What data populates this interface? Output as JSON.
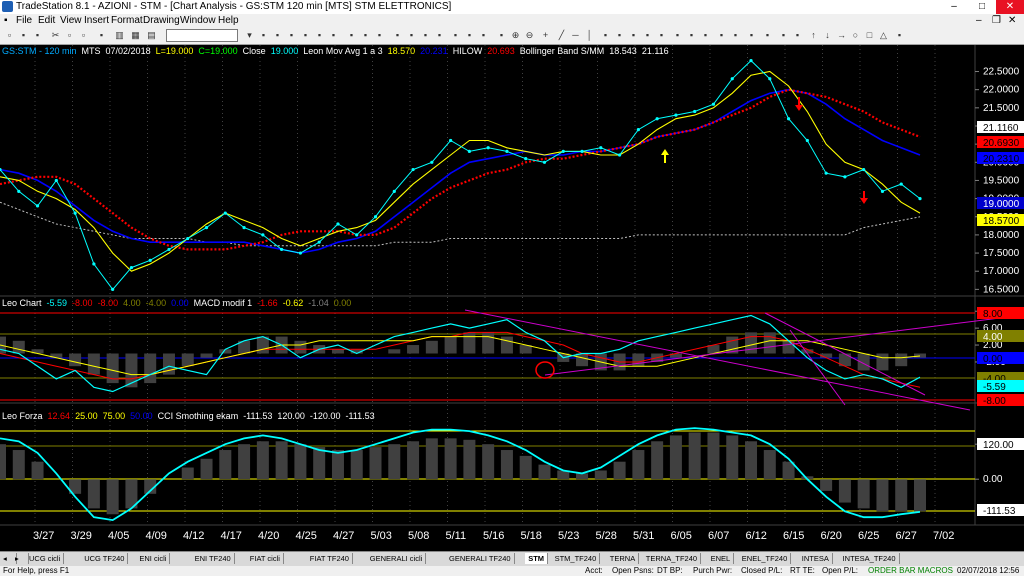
{
  "window": {
    "title": "TradeStation 8.1 - AZIONI - STM - [Chart Analysis - GS:STM  120 min  [MTS] STM ELETTRONICS]",
    "minimize": "–",
    "maximize": "□",
    "close": "✕"
  },
  "menu": [
    "File",
    "Edit",
    "View",
    "Insert",
    "Format",
    "Drawing",
    "Window",
    "Help"
  ],
  "chart_data": [
    {
      "type": "line",
      "pane": "price",
      "title": "GS:STM - 120 min",
      "legend": [
        {
          "text": "GS:STM - 120 min",
          "color": "#00aaff"
        },
        {
          "text": "MTS",
          "color": "#ffffff"
        },
        {
          "text": "07/02/2018",
          "color": "#ffffff"
        },
        {
          "text": "L=19.000",
          "color": "#ffff00"
        },
        {
          "text": "C=19.000",
          "color": "#00ff00"
        },
        {
          "text": "Close",
          "color": "#ffffff"
        },
        {
          "text": "19.000",
          "color": "#00ffff"
        },
        {
          "text": "Leon Mov Avg 1 a 3",
          "color": "#ffffff"
        },
        {
          "text": "18.570",
          "color": "#ffff00"
        },
        {
          "text": "20.231",
          "color": "#0000ff"
        },
        {
          "text": "HILOW",
          "color": "#ffffff"
        },
        {
          "text": "20.693",
          "color": "#ff0000"
        },
        {
          "text": "Bollinger Band S/MM",
          "color": "#ffffff"
        },
        {
          "text": "18.543",
          "color": "#ffffff"
        },
        {
          "text": "21.116",
          "color": "#ffffff"
        }
      ],
      "yticks": [
        "22.5000",
        "22.0000",
        "21.5000",
        "21.0000",
        "20.5000",
        "20.0000",
        "19.5000",
        "19.0000",
        "18.5000",
        "18.0000",
        "17.5000",
        "17.0000",
        "16.5000"
      ],
      "value_tags": [
        {
          "text": "21.1160",
          "bg": "#ffffff",
          "fg": "#000000"
        },
        {
          "text": "20.6930",
          "bg": "#ff0000",
          "fg": "#000000"
        },
        {
          "text": "20.2310",
          "bg": "#0000ff",
          "fg": "#000000"
        },
        {
          "text": "19.0000",
          "bg": "#0000cc",
          "fg": "#ffffff"
        },
        {
          "text": "18.5700",
          "bg": "#ffff00",
          "fg": "#000000"
        }
      ],
      "ylim": [
        16.4,
        22.9
      ],
      "series": [
        {
          "name": "Close",
          "color": "#00ffff",
          "values": [
            19.8,
            19.2,
            18.8,
            19.5,
            18.6,
            17.2,
            16.5,
            17.1,
            17.3,
            17.6,
            17.9,
            18.2,
            18.6,
            18.2,
            18.0,
            17.6,
            17.5,
            17.8,
            18.3,
            18.0,
            18.5,
            19.2,
            19.8,
            20.0,
            20.6,
            20.3,
            20.4,
            20.3,
            20.1,
            20.0,
            20.3,
            20.3,
            20.4,
            20.2,
            20.9,
            21.2,
            21.3,
            21.4,
            21.6,
            22.3,
            22.8,
            22.3,
            21.2,
            20.6,
            19.7,
            19.6,
            19.8,
            19.2,
            19.4,
            19.0
          ]
        },
        {
          "name": "Leon Mov Avg 1 a 3",
          "color": "#ffff00",
          "values": [
            19.6,
            19.5,
            19.2,
            19.0,
            18.7,
            18.2,
            17.5,
            17.0,
            17.2,
            17.5,
            17.9,
            18.3,
            18.6,
            18.4,
            18.2,
            17.9,
            17.7,
            17.9,
            18.1,
            18.2,
            18.4,
            18.9,
            19.4,
            19.8,
            20.2,
            20.6,
            20.6,
            20.4,
            20.3,
            20.2,
            20.3,
            20.3,
            20.2,
            20.2,
            20.5,
            20.9,
            21.2,
            21.3,
            21.5,
            21.9,
            22.4,
            22.5,
            22.1,
            21.4,
            20.5,
            20.0,
            19.8,
            19.4,
            18.9,
            18.6
          ]
        },
        {
          "name": "Leon Mov Avg (blue)",
          "color": "#0000ff",
          "values": [
            19.8,
            19.7,
            19.5,
            19.2,
            18.8,
            18.4,
            18.1,
            17.9,
            17.8,
            17.8,
            17.8,
            17.8,
            17.8,
            17.8,
            17.7,
            17.6,
            17.5,
            17.6,
            17.8,
            17.9,
            18.1,
            18.5,
            18.9,
            19.3,
            19.7,
            20.0,
            20.1,
            20.2,
            20.3,
            20.2,
            20.2,
            20.3,
            20.3,
            20.4,
            20.5,
            20.7,
            20.8,
            20.9,
            21.1,
            21.4,
            21.7,
            21.9,
            22.0,
            21.9,
            21.6,
            21.2,
            20.9,
            20.6,
            20.4,
            20.2
          ]
        },
        {
          "name": "HILOW",
          "color": "#ff0000",
          "values": [
            19.4,
            19.5,
            19.6,
            19.6,
            19.4,
            19.0,
            18.6,
            18.2,
            17.9,
            17.7,
            17.6,
            17.6,
            17.6,
            17.7,
            17.8,
            18.0,
            18.1,
            18.1,
            18.1,
            18.0,
            18.0,
            18.2,
            18.6,
            19.0,
            19.3,
            19.5,
            19.7,
            19.8,
            20.0,
            20.1,
            20.1,
            20.2,
            20.3,
            20.4,
            20.5,
            20.7,
            20.8,
            20.9,
            21.1,
            21.3,
            21.5,
            21.8,
            22.0,
            21.9,
            21.8,
            21.6,
            21.4,
            21.1,
            20.9,
            20.7
          ]
        },
        {
          "name": "Bollinger Band S/MM",
          "color": "#c0c0c0",
          "values": [
            18.9,
            18.7,
            18.5,
            18.3,
            18.2,
            18.1,
            18.0,
            17.9,
            17.9,
            17.9,
            17.9,
            17.8,
            17.8,
            17.7,
            17.7,
            17.7,
            17.7,
            17.7,
            17.7,
            17.7,
            17.7,
            17.8,
            17.8,
            17.8,
            17.9,
            17.9,
            17.9,
            17.9,
            17.9,
            17.9,
            17.9,
            17.9,
            17.9,
            17.9,
            18.0,
            18.0,
            18.0,
            18.0,
            18.0,
            18.0,
            18.0,
            18.0,
            18.0,
            18.0,
            18.0,
            18.0,
            18.2,
            18.3,
            18.4,
            18.5
          ]
        }
      ]
    },
    {
      "type": "line",
      "pane": "macd",
      "legend": [
        {
          "text": "Leo Chart",
          "color": "#ffffff"
        },
        {
          "text": "-5.59",
          "color": "#00ffff"
        },
        {
          "text": "-8.00",
          "color": "#ff0000"
        },
        {
          "text": "-8.00",
          "color": "#ff0000"
        },
        {
          "text": "4.00",
          "color": "#808000"
        },
        {
          "text": "-4.00",
          "color": "#808000"
        },
        {
          "text": "0.00",
          "color": "#0000ff"
        },
        {
          "text": "MACD modif 1",
          "color": "#ffffff"
        },
        {
          "text": "-1.66",
          "color": "#ff0000"
        },
        {
          "text": "-0.62",
          "color": "#ffff00"
        },
        {
          "text": "-1.04",
          "color": "#808080"
        },
        {
          "text": "0.00",
          "color": "#808000"
        }
      ],
      "yticks": [
        "10.00",
        "6.00",
        "2.00",
        "-2.00"
      ],
      "value_tags": [
        {
          "text": "8.00",
          "bg": "#ff0000",
          "fg": "#000000"
        },
        {
          "text": "4.00",
          "bg": "#808000",
          "fg": "#ffffff"
        },
        {
          "text": "0.00",
          "bg": "#0000ff",
          "fg": "#000000"
        },
        {
          "text": "-4.00",
          "bg": "#808000",
          "fg": "#000000"
        },
        {
          "text": "-5.59",
          "bg": "#00ffff",
          "fg": "#000000"
        },
        {
          "text": "-8.00",
          "bg": "#ff0000",
          "fg": "#000000"
        }
      ],
      "ylim": [
        -11,
        11
      ],
      "series": [
        {
          "name": "Leo Chart",
          "color": "#00ffff",
          "values": [
            1,
            0,
            -3,
            -6,
            -4,
            -8,
            -9,
            -7,
            -5,
            -3,
            -4,
            -5,
            1,
            3,
            4,
            2,
            -1,
            1,
            2,
            0,
            2,
            4,
            5,
            6,
            7,
            6,
            7,
            8,
            5,
            3,
            -1,
            0,
            0,
            1,
            3,
            4,
            5,
            6,
            7,
            8,
            9,
            7,
            3,
            -1,
            -4,
            -6,
            -5,
            -6,
            -8,
            -5.6
          ]
        },
        {
          "name": "MACD modif 1",
          "color": "#ff0000",
          "values": [
            0,
            -1,
            -2,
            -3,
            -4,
            -5,
            -6,
            -6,
            -5,
            -4,
            -3,
            -2,
            -1,
            0,
            1,
            1,
            1,
            1,
            1,
            1,
            1,
            2,
            3,
            4,
            4,
            5,
            5,
            5,
            4,
            3,
            2,
            0,
            -1,
            -2,
            -2,
            -1,
            0,
            1,
            2,
            3,
            4,
            4,
            3,
            1,
            -1,
            -3,
            -5,
            -6,
            -7,
            -8
          ]
        },
        {
          "name": "signal",
          "color": "#ffff00",
          "values": [
            2,
            1,
            0,
            -1,
            -2,
            -3,
            -4,
            -5,
            -5,
            -4,
            -3,
            -2,
            -1,
            0,
            1,
            2,
            2,
            3,
            3,
            3,
            3,
            3,
            3,
            4,
            4,
            4,
            4,
            3,
            2,
            1,
            0,
            -1,
            -2,
            -3,
            -3,
            -3,
            -2,
            -1,
            0,
            1,
            2,
            3,
            3,
            3,
            2,
            1,
            0,
            -1,
            -1,
            -0.6
          ]
        },
        {
          "name": "histogram",
          "color": "#808080",
          "values": [
            4,
            3,
            1,
            -1,
            -3,
            -5,
            -7,
            -8,
            -7,
            -5,
            -3,
            -1,
            1,
            3,
            4,
            4,
            3,
            2,
            1,
            1,
            0,
            1,
            2,
            3,
            4,
            5,
            5,
            4,
            2,
            0,
            -2,
            -3,
            -4,
            -4,
            -3,
            -2,
            -1,
            0,
            2,
            4,
            5,
            5,
            3,
            1,
            -1,
            -3,
            -4,
            -4,
            -3,
            -1
          ]
        }
      ]
    },
    {
      "type": "line",
      "pane": "cci",
      "legend": [
        {
          "text": "Leo Forza",
          "color": "#ffffff"
        },
        {
          "text": "12.64",
          "color": "#ff0000"
        },
        {
          "text": "25.00",
          "color": "#ffff00"
        },
        {
          "text": "75.00",
          "color": "#ffff00"
        },
        {
          "text": "50.00",
          "color": "#0000ff"
        },
        {
          "text": "CCI Smothing ekam",
          "color": "#ffffff"
        },
        {
          "text": "-111.53",
          "color": "#ffffff"
        },
        {
          "text": "120.00",
          "color": "#ffffff"
        },
        {
          "text": "-120.00",
          "color": "#ffffff"
        },
        {
          "text": "-111.53",
          "color": "#ffffff"
        }
      ],
      "yticks": [
        "120.00",
        "0.00"
      ],
      "value_tags": [
        {
          "text": "120.00",
          "bg": "#ffffff",
          "fg": "#000000"
        },
        {
          "text": "-111.53",
          "bg": "#ffffff",
          "fg": "#000000"
        }
      ],
      "ylim": [
        -150,
        220
      ],
      "series": [
        {
          "name": "Leo Forza / CCI",
          "color": "#00ffff",
          "values": [
            140,
            130,
            90,
            20,
            -60,
            -130,
            -140,
            -100,
            -40,
            20,
            60,
            90,
            120,
            140,
            150,
            140,
            120,
            100,
            90,
            100,
            120,
            140,
            160,
            170,
            170,
            165,
            150,
            130,
            100,
            60,
            30,
            20,
            40,
            80,
            120,
            150,
            170,
            175,
            170,
            160,
            150,
            120,
            70,
            0,
            -60,
            -110,
            -130,
            -130,
            -120,
            -112
          ]
        },
        {
          "name": "CCI Smothing ekam",
          "color": "#808080",
          "values": [
            120,
            100,
            60,
            0,
            -50,
            -100,
            -120,
            -100,
            -50,
            0,
            40,
            70,
            100,
            120,
            130,
            130,
            120,
            110,
            100,
            100,
            110,
            120,
            130,
            140,
            140,
            135,
            120,
            100,
            80,
            50,
            30,
            20,
            30,
            60,
            100,
            130,
            150,
            160,
            160,
            150,
            130,
            100,
            60,
            10,
            -40,
            -80,
            -100,
            -110,
            -110,
            -110
          ]
        }
      ]
    }
  ],
  "x_labels": [
    "3/27",
    "3/29",
    "4/05",
    "4/09",
    "4/12",
    "4/17",
    "4/20",
    "4/25",
    "4/27",
    "5/03",
    "5/08",
    "5/11",
    "5/16",
    "5/18",
    "5/23",
    "5/28",
    "5/31",
    "6/05",
    "6/07",
    "6/12",
    "6/15",
    "6/20",
    "6/25",
    "6/27",
    "7/02"
  ],
  "tabs": [
    "UCG cicli",
    "UCG TF240",
    "ENI cicli",
    "ENI TF240",
    "FIAT cicli",
    "FIAT TF240",
    "GENERALI cicli",
    "GENERALI TF240",
    "STM",
    "STM_TF240",
    "TERNA",
    "TERNA_TF240",
    "ENEL",
    "ENEL_TF240",
    "INTESA",
    "INTESA_TF240"
  ],
  "active_tab": "STM",
  "status": {
    "help": "For Help, press F1",
    "acct": "Acct:",
    "open_psns": "Open Psns:",
    "dt_bp": "DT BP:",
    "purch_pwr": "Purch Pwr:",
    "closed_pl": "Closed P/L:",
    "rt_te": "RT TE:",
    "open_pl": "Open P/L:",
    "order_bar": "ORDER BAR  MACROS",
    "datetime": "02/07/2018 12:56"
  },
  "colors": {
    "bg": "#000000",
    "ui": "#f0f0f0",
    "accent": "#00ffff"
  }
}
